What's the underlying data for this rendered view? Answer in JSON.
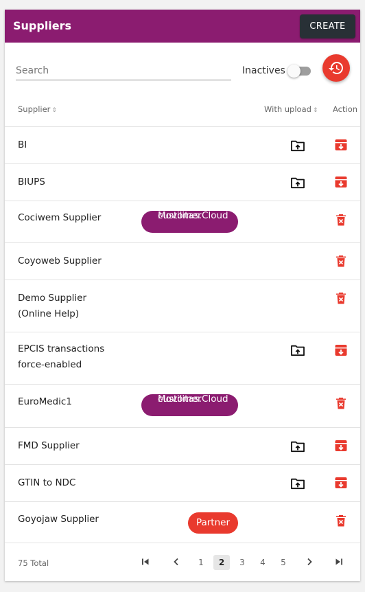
{
  "header": {
    "title": "Suppliers",
    "create_label": "CREATE"
  },
  "toolbar": {
    "search_placeholder": "Search",
    "inactives_label": "Inactives",
    "inactives_on": false
  },
  "table": {
    "columns": {
      "supplier": "Supplier",
      "with_upload": "With upload",
      "action": "Action"
    },
    "rows": [
      {
        "name1": "BI",
        "name2": "",
        "upload": true,
        "action_icon": "archive-icon"
      },
      {
        "name1": "BIUPS",
        "name2": "",
        "upload": true,
        "action_icon": "archive-icon"
      },
      {
        "name1": "Cociwem Supplier",
        "name2": "",
        "chip1": "Movilitas.Cloud",
        "chip2": "customer",
        "upload": false,
        "action_icon": "delete-icon"
      },
      {
        "name1": "Coyoweb Supplier",
        "name2": "",
        "upload": false,
        "action_icon": "delete-icon"
      },
      {
        "name1": "Demo Supplier",
        "name2": "(Online Help)",
        "upload": false,
        "action_icon": "delete-icon"
      },
      {
        "name1": "EPCIS transactions",
        "name2": "force-enabled",
        "upload": true,
        "action_icon": "archive-icon"
      },
      {
        "name1": "EuroMedic1",
        "name2": "",
        "chip1": "Movilitas.Cloud",
        "chip2": "customer",
        "upload": false,
        "action_icon": "delete-icon"
      },
      {
        "name1": "FMD Supplier",
        "name2": "",
        "upload": true,
        "action_icon": "archive-icon"
      },
      {
        "name1": "GTIN to NDC",
        "name2": "",
        "upload": true,
        "action_icon": "archive-icon"
      },
      {
        "name1": "Goyojaw Supplier",
        "name2": "",
        "partner": "Partner",
        "upload": false,
        "action_icon": "delete-icon"
      }
    ]
  },
  "pagination": {
    "total": "75 Total",
    "pages": [
      "1",
      "2",
      "3",
      "4",
      "5"
    ],
    "current": "2"
  },
  "colors": {
    "brand": "#8b1c70",
    "accent": "#e93a2e",
    "dark": "#283036"
  }
}
